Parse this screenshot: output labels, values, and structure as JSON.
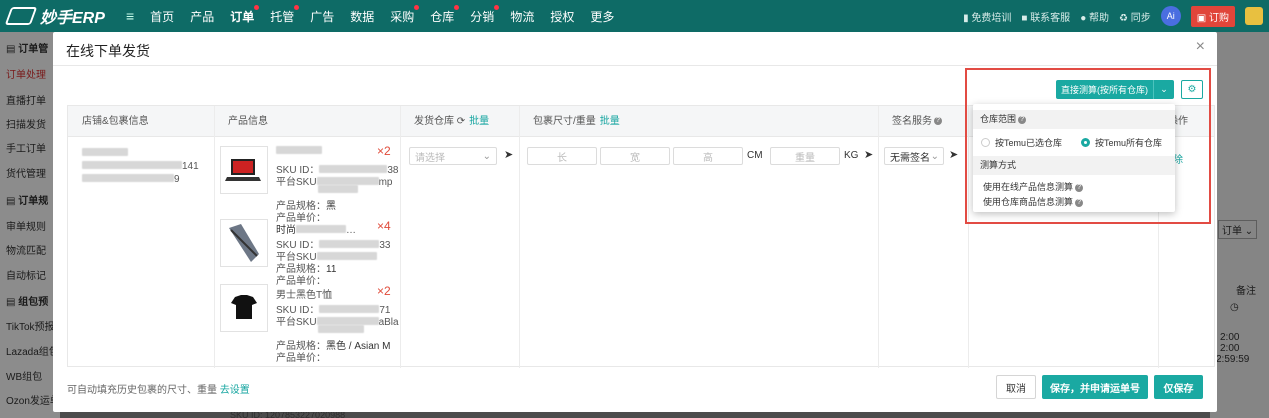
{
  "topbar": {
    "logo": "妙手ERP",
    "nav": [
      {
        "label": "首页",
        "dot": false
      },
      {
        "label": "产品",
        "dot": false
      },
      {
        "label": "订单",
        "dot": true
      },
      {
        "label": "托管",
        "dot": true
      },
      {
        "label": "广告",
        "dot": false
      },
      {
        "label": "数据",
        "dot": false
      },
      {
        "label": "采购",
        "dot": true
      },
      {
        "label": "仓库",
        "dot": true
      },
      {
        "label": "分销",
        "dot": true
      },
      {
        "label": "物流",
        "dot": false
      },
      {
        "label": "授权",
        "dot": false
      },
      {
        "label": "更多",
        "dot": false
      }
    ],
    "right": {
      "training": "免费培训",
      "support": "联系客服",
      "help": "帮助",
      "sync": "同步",
      "ai": "Ai",
      "order": "订购"
    }
  },
  "sidebar": {
    "items": [
      "订单管",
      "订单处理",
      "直播打单",
      "扫描发货",
      "手工订单",
      "货代管理",
      "订单规",
      "审单规则",
      "物流匹配",
      "自动标记",
      "组包预",
      "TikTok预报",
      "Lazada组包",
      "WB组包",
      "Ozon发运单"
    ]
  },
  "background": {
    "order_dropdown": "订单",
    "remark": "备注",
    "time1": "2:00",
    "time2": "2:00",
    "time3": "2:59:59",
    "sku_line": "SKU ID: 1207853227020988"
  },
  "modal": {
    "title": "在线下单发货",
    "close": "×",
    "measure_button": "直接测算(按所有仓库)",
    "columns": {
      "store": "店铺&包裹信息",
      "product": "产品信息",
      "warehouse": "发货仓库",
      "warehouse_link": "批量",
      "package": "包裹尺寸/重量",
      "package_link": "批量",
      "sign": "签名服务",
      "action": "操作"
    },
    "store": {
      "line1_suffix": "141",
      "line2_suffix": "9"
    },
    "products": [
      {
        "qty": "×2",
        "sku_label": "SKU ID：",
        "sku_tail": "38",
        "platform_label": "平台SKU",
        "platform_tail": "mp",
        "spec_label": "产品规格：",
        "spec": "黑",
        "price_label": "产品单价："
      },
      {
        "name": "时尚",
        "qty": "×4",
        "sku_label": "SKU ID：",
        "sku_tail": "33",
        "platform_label": "平台SKU",
        "spec_label": "产品规格：",
        "spec": "11",
        "price_label": "产品单价："
      },
      {
        "name": "男士黑色T恤",
        "qty": "×2",
        "sku_label": "SKU ID：",
        "sku_tail": "71",
        "platform_label": "平台SKU",
        "platform_tail": "aBla",
        "spec_label": "产品规格：",
        "spec": "黑色 / Asian M",
        "price_label": "产品单价："
      }
    ],
    "inputs": {
      "warehouse_placeholder": "请选择",
      "length": "长",
      "width": "宽",
      "height": "高",
      "cm": "CM",
      "weight": "重量",
      "kg": "KG",
      "sign_value": "无需签名",
      "action_link": "除"
    },
    "popup": {
      "range_title": "仓库范围",
      "option_selected_only": "按Temu已选仓库",
      "option_all": "按Temu所有仓库",
      "method_title": "测算方式",
      "method_online": "使用在线产品信息测算",
      "method_warehouse": "使用仓库商品信息测算"
    },
    "footer": {
      "hint": "可自动填充历史包裹的尺寸、重量",
      "hint_link": "去设置",
      "cancel": "取消",
      "save_apply": "保存，并申请运单号",
      "save_only": "仅保存"
    }
  },
  "colors": {
    "brand": "#0e6b66",
    "accent": "#1aa9a2",
    "alert": "#e24b43"
  }
}
